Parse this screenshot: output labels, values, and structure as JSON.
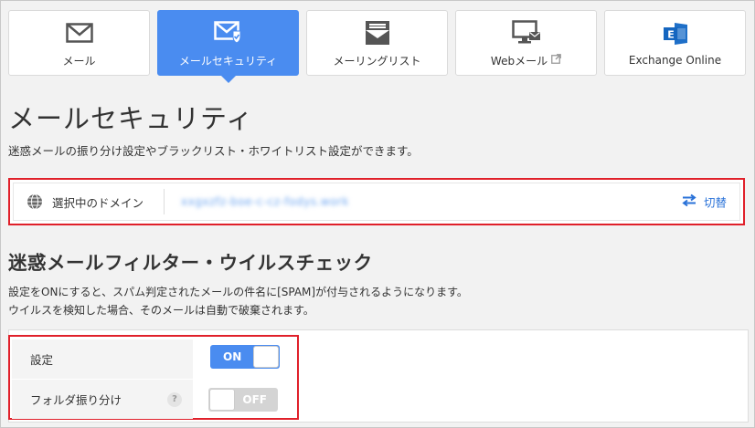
{
  "tabs": [
    {
      "label": "メール",
      "icon": "envelope-icon"
    },
    {
      "label": "メールセキュリティ",
      "icon": "envelope-shield-icon",
      "active": true
    },
    {
      "label": "メーリングリスト",
      "icon": "mailing-list-icon"
    },
    {
      "label": "Webメール",
      "icon": "monitor-mail-icon",
      "external": true
    },
    {
      "label": "Exchange Online",
      "icon": "exchange-icon"
    }
  ],
  "page": {
    "title": "メールセキュリティ",
    "description": "迷惑メールの振り分け設定やブラックリスト・ホワイトリスト設定ができます。"
  },
  "domain": {
    "label": "選択中のドメイン",
    "value": "xxgxzfz-boe-c-cz-fodys.work",
    "switch_label": "切替"
  },
  "filter": {
    "title": "迷惑メールフィルター・ウイルスチェック",
    "desc1": "設定をONにすると、スパム判定されたメールの件名に[SPAM]が付与されるようになります。",
    "desc2": "ウイルスを検知した場合、そのメールは自動で破棄されます。",
    "settings": [
      {
        "label": "設定",
        "state": "ON",
        "on": true
      },
      {
        "label": "フォルダ振り分け",
        "state": "OFF",
        "on": false,
        "help": "?"
      }
    ]
  },
  "colors": {
    "accent": "#4a8cf0",
    "highlight": "#e0202a",
    "link": "#2a72d8"
  }
}
